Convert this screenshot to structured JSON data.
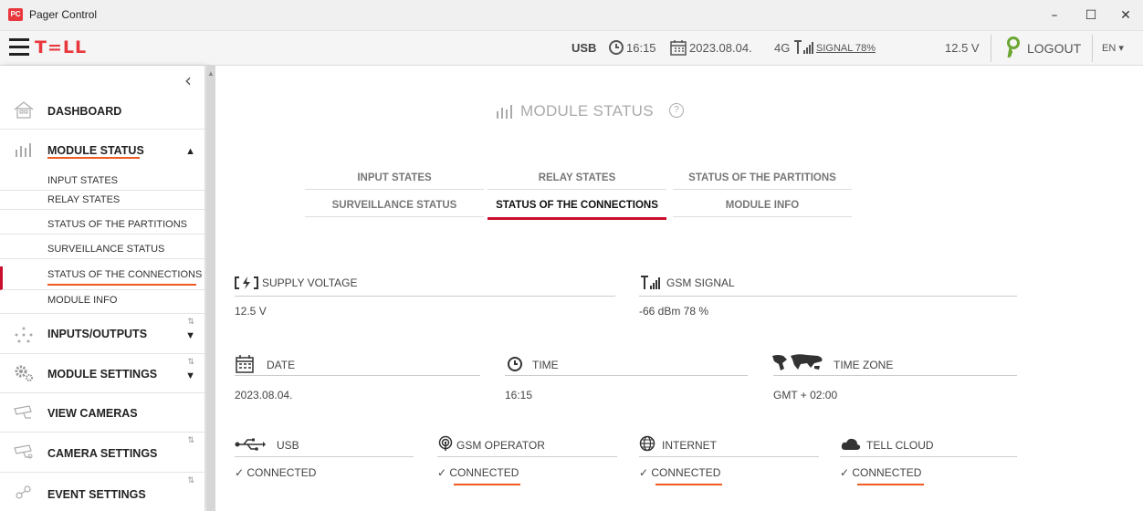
{
  "window": {
    "app_icon_text": "PC",
    "title": "Pager Control",
    "minimize": "–",
    "maximize": "☐",
    "close": "✕"
  },
  "header": {
    "logo": "T=LL",
    "connection": "USB",
    "time": "16:15",
    "date": "2023.08.04.",
    "network": "4G",
    "signal": "SIGNAL 78%",
    "voltage": "12.5 V",
    "logout": "LOGOUT",
    "language": "EN ▾"
  },
  "sidebar": {
    "collapse": "‹",
    "items": [
      {
        "label": "DASHBOARD"
      },
      {
        "label": "MODULE STATUS",
        "arrow": "▲"
      },
      {
        "label": "INPUTS/OUTPUTS",
        "arrow": "▼"
      },
      {
        "label": "MODULE SETTINGS",
        "arrow": "▼"
      },
      {
        "label": "VIEW CAMERAS"
      },
      {
        "label": "CAMERA SETTINGS"
      },
      {
        "label": "EVENT SETTINGS"
      }
    ],
    "submenu": [
      {
        "label": "INPUT STATES"
      },
      {
        "label": "RELAY STATES"
      },
      {
        "label": "STATUS OF THE PARTITIONS"
      },
      {
        "label": "SURVEILLANCE STATUS"
      },
      {
        "label": "STATUS OF THE CONNECTIONS"
      },
      {
        "label": "MODULE INFO"
      }
    ],
    "sort_glyph": "⇅"
  },
  "main": {
    "title": "MODULE STATUS",
    "help": "?",
    "tabs": [
      {
        "label": "INPUT STATES"
      },
      {
        "label": "RELAY STATES"
      },
      {
        "label": "STATUS OF THE PARTITIONS"
      },
      {
        "label": "SURVEILLANCE STATUS"
      },
      {
        "label": "STATUS OF THE CONNECTIONS"
      },
      {
        "label": "MODULE INFO"
      }
    ],
    "fields": {
      "supply_voltage": {
        "label": "SUPPLY VOLTAGE",
        "value": "12.5 V"
      },
      "gsm_signal": {
        "label": "GSM SIGNAL",
        "value": "-66 dBm 78 %"
      },
      "date": {
        "label": "DATE",
        "value": "2023.08.04."
      },
      "time": {
        "label": "TIME",
        "value": "16:15"
      },
      "time_zone": {
        "label": "TIME ZONE",
        "value": "GMT + 02:00"
      },
      "usb": {
        "label": "USB",
        "value": "✓ CONNECTED"
      },
      "gsm_operator": {
        "label": "GSM OPERATOR",
        "value": "✓ CONNECTED"
      },
      "internet": {
        "label": "INTERNET",
        "value": "✓ CONNECTED"
      },
      "tell_cloud": {
        "label": "TELL CLOUD",
        "value": "✓ CONNECTED"
      }
    }
  },
  "colors": {
    "accent_red": "#c8102e",
    "highlight_orange": "#f15a22",
    "logo_red": "#e8383d"
  }
}
